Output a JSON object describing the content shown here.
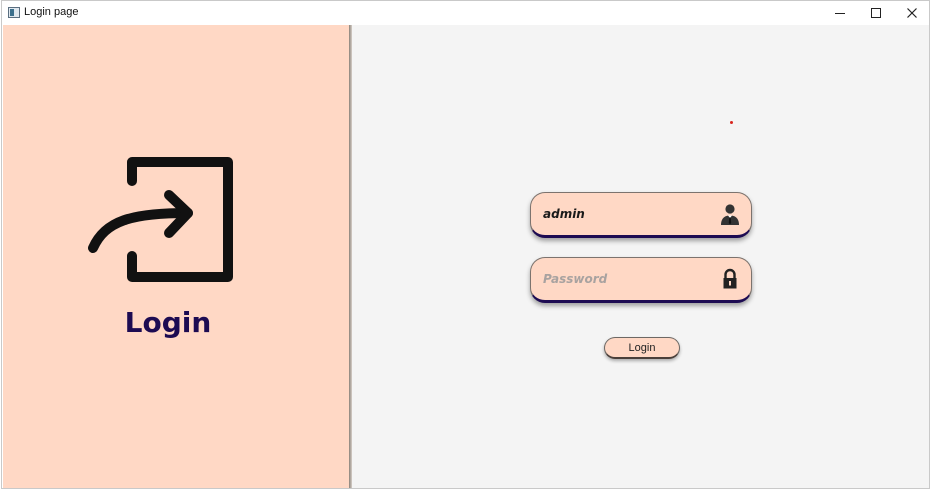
{
  "window": {
    "title": "Login page",
    "controls": [
      "minimize",
      "maximize",
      "close"
    ]
  },
  "left_panel": {
    "icon": "login-arrow-icon",
    "heading": "Login",
    "background": "#ffd8c5",
    "heading_color": "#1d0b52"
  },
  "form": {
    "username": {
      "value": "admin",
      "placeholder": "",
      "icon": "user-icon"
    },
    "password": {
      "value": "",
      "placeholder": "Password",
      "icon": "lock-icon"
    },
    "submit_label": "Login"
  },
  "colors": {
    "field_background": "#ffd8c5",
    "field_border_bottom": "#1d0b52",
    "content_background": "#f4f4f4"
  }
}
